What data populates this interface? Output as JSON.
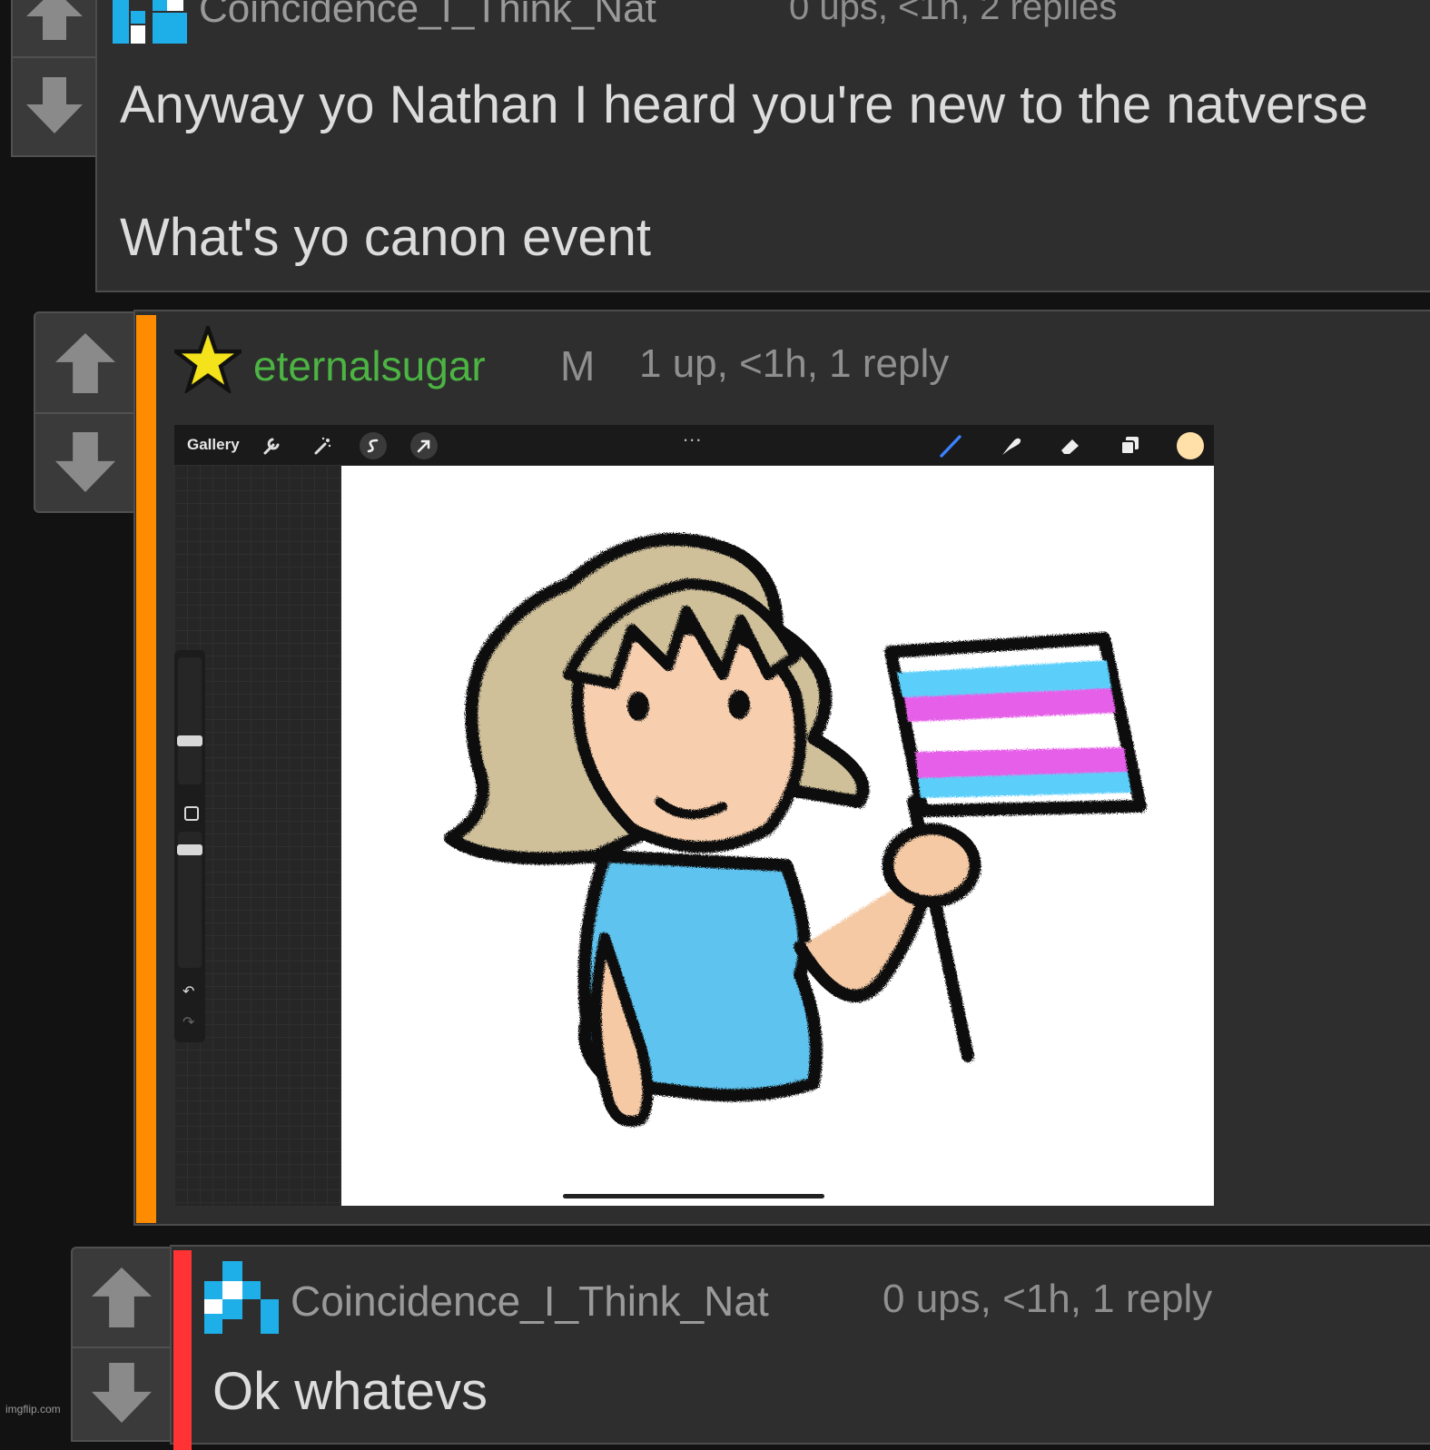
{
  "comment_top": {
    "username": "Coincidence_I_Think_Nat",
    "meta": "0 ups, <1h, 2 replies",
    "line1": "Anyway yo Nathan I heard you're new to the natverse",
    "line2": "What's yo canon event"
  },
  "comment_main": {
    "username": "eternalsugar",
    "mod_badge": "M",
    "meta": "1 up, <1h, 1 reply",
    "accent_color": "#ff8b00",
    "username_color": "#4cb443",
    "image": {
      "toolbar": {
        "gallery_label": "Gallery",
        "more_label": "...",
        "color_swatch": "#ffe0a8"
      },
      "flag_colors": [
        "#5bcefa",
        "#f5a9b8",
        "#ffffff",
        "#f5a9b8",
        "#5bcefa"
      ]
    }
  },
  "comment_reply": {
    "username": "Coincidence_I_Think_Nat",
    "meta": "0 ups, <1h, 1 reply",
    "body": "Ok whatevs",
    "accent_color": "#ff3333"
  },
  "watermark": "imgflip.com",
  "icons": {
    "upvote": "up-arrow-icon",
    "downvote": "down-arrow-icon",
    "avatar": "pixel-avatar-icon",
    "star": "star-icon"
  }
}
